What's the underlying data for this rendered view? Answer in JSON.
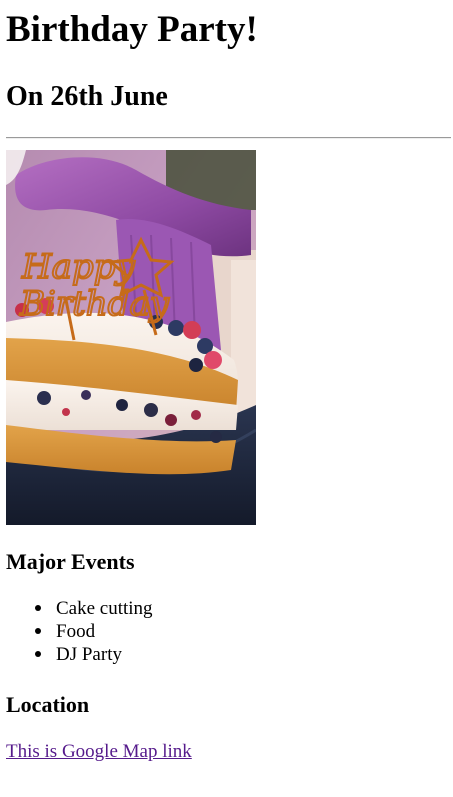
{
  "page": {
    "title": "Birthday Party!",
    "subtitle": "On 26th June"
  },
  "image": {
    "topper_text": "Happy Birthday"
  },
  "events": {
    "heading": "Major Events",
    "items": [
      "Cake cutting",
      "Food",
      "DJ Party"
    ]
  },
  "location": {
    "heading": "Location",
    "link_text": "This is Google Map link"
  },
  "colors": {
    "link_visited": "#551a8b",
    "rule": "#9a9a9a"
  }
}
